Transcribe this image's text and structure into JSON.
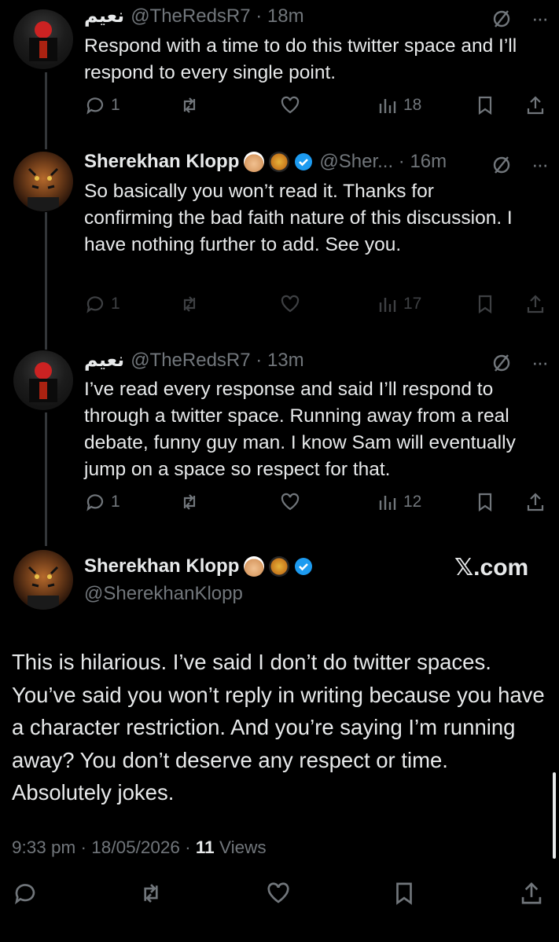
{
  "tweets": [
    {
      "display_name": "نعيم",
      "handle_time": "@TheRedsR7 · 18m",
      "text": "Respond with a time to do this twitter space and I’ll respond to every single point.",
      "replies": "1",
      "views": "18"
    },
    {
      "display_name": "Sherekhan Klopp",
      "handle_time": "@Sher... · 16m",
      "text": "So basically you won’t read it. Thanks for confirming the bad faith nature of this discussion. I have nothing further to add. See you.",
      "replies": "1",
      "views": "17"
    },
    {
      "display_name": "نعيم",
      "handle_time": "@TheRedsR7 · 13m",
      "text": "I’ve read every response and said I’ll respond to through a twitter space. Running away from a real debate, funny guy man. I know Sam will eventually jump on a space so respect for that.",
      "replies": "1",
      "views": "12"
    }
  ],
  "main_tweet": {
    "display_name": "Sherekhan Klopp",
    "handle": "@SherekhanKlopp",
    "watermark": "𝕏.com",
    "text": "This is hilarious. I’ve said I don’t do twitter spaces. You’ve said you won’t reply in writing because you have a character restriction. And you’re saying I’m running away? You don’t deserve any respect or time. Absolutely jokes.",
    "time_date": "9:33 pm · 18/05/2026 · ",
    "views_count": "11",
    "views_label": "Views"
  },
  "colors": {
    "background": "#000000",
    "text": "#e7e9ea",
    "muted": "#71767b",
    "verified": "#1d9bf0"
  },
  "icons": [
    "reply-icon",
    "retweet-icon",
    "like-icon",
    "views-icon",
    "bookmark-icon",
    "share-icon",
    "grok-icon",
    "more-icon",
    "verified-icon"
  ]
}
